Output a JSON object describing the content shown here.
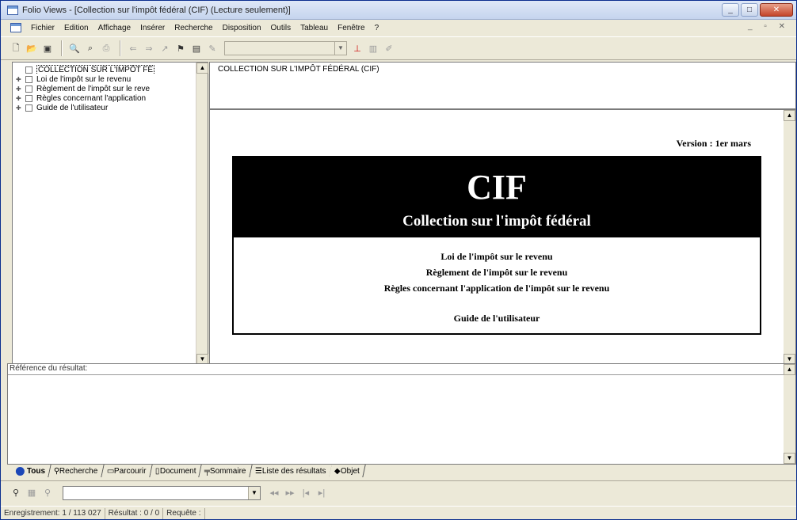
{
  "window": {
    "title": "Folio Views - [Collection sur l'impôt fédéral (CIF) (Lecture seulement)]"
  },
  "menu": [
    "Fichier",
    "Edition",
    "Affichage",
    "Insérer",
    "Recherche",
    "Disposition",
    "Outils",
    "Tableau",
    "Fenêtre",
    "?"
  ],
  "toc": {
    "items": [
      {
        "label": "COLLECTION SUR L'IMPÔT FÉ"
      },
      {
        "label": "Loi de l'impôt sur le revenu"
      },
      {
        "label": "Règlement de l'impôt sur le reve"
      },
      {
        "label": "Règles concernant l'application"
      },
      {
        "label": "Guide de l'utilisateur"
      }
    ]
  },
  "header_pane": {
    "text": "COLLECTION SUR L'IMPÔT FÉDÉRAL (CIF)"
  },
  "document": {
    "version": "Version : 1er mars",
    "title": "CIF",
    "subtitle": "Collection sur l'impôt fédéral",
    "links": [
      "Loi de l'impôt sur le revenu",
      "Règlement de l'impôt sur le revenu",
      "Règles concernant l'application de l'impôt sur le revenu"
    ],
    "guide": "Guide de l'utilisateur"
  },
  "results": {
    "header": "Référence du résultat:"
  },
  "tabs": [
    "Tous",
    "Recherche",
    "Parcourir",
    "Document",
    "Sommaire",
    "Liste des résultats",
    "Objet"
  ],
  "status": {
    "record": "Enregistrement: 1 / 113 027",
    "result": "Résultat : 0 / 0",
    "query": "Requête :"
  }
}
